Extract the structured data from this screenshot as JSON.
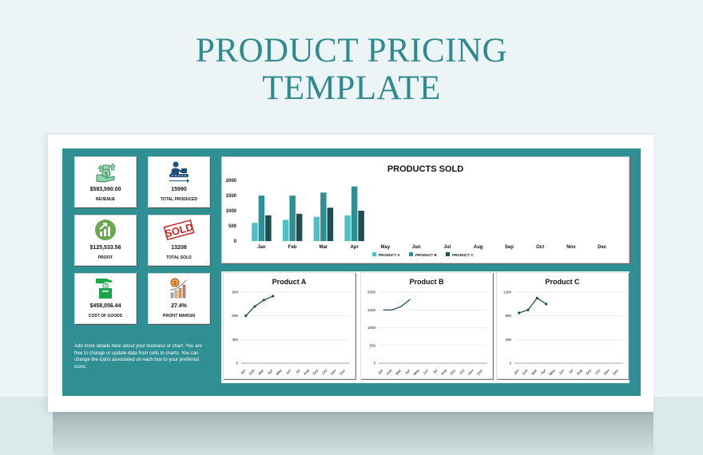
{
  "page": {
    "title_line1": "PRODUCT PRICING",
    "title_line2": "TEMPLATE"
  },
  "kpis": [
    {
      "value": "$583,590.00",
      "label": "REVENUE",
      "icon": "money-growth-icon"
    },
    {
      "value": "15990",
      "label": "TOTAL PRODUCED",
      "icon": "conveyor-worker-icon"
    },
    {
      "value": "$125,533.56",
      "label": "PROFIT",
      "icon": "growth-chart-icon"
    },
    {
      "value": "13208",
      "label": "TOTAL SOLD",
      "icon": "sold-stamp-icon"
    },
    {
      "value": "$458,056.44",
      "label": "COST OF GOODS",
      "icon": "hand-coin-box-icon"
    },
    {
      "value": "27.4%",
      "label": "PROFIT MARGIN",
      "icon": "coin-bar-chart-icon"
    }
  ],
  "sold_stamp_text": "SOLD",
  "note": "Add more details here about your business or chart. You are free to change or update data from cells to charts. You can change the icons associated on each box to your preferred icons.",
  "colors": {
    "teal": "#2f8f93",
    "product_a": "#4fc0c8",
    "product_b": "#2e8f94",
    "product_c": "#1d4f52",
    "line": "#1d4f52"
  },
  "chart_data": [
    {
      "type": "bar",
      "title": "PRODUCTS SOLD",
      "categories": [
        "Jan",
        "Feb",
        "Mar",
        "Apr",
        "May",
        "Jun",
        "Jul",
        "Aug",
        "Sep",
        "Oct",
        "Nov",
        "Dec"
      ],
      "series": [
        {
          "name": "PRODUCT A",
          "values": [
            600,
            700,
            800,
            850,
            null,
            null,
            null,
            null,
            null,
            null,
            null,
            null
          ]
        },
        {
          "name": "PRODUCT B",
          "values": [
            1500,
            1500,
            1600,
            1800,
            null,
            null,
            null,
            null,
            null,
            null,
            null,
            null
          ]
        },
        {
          "name": "PRODUCT C",
          "values": [
            850,
            900,
            1100,
            1000,
            null,
            null,
            null,
            null,
            null,
            null,
            null,
            null
          ]
        }
      ],
      "yticks": [
        0,
        500,
        1000,
        1500,
        2000
      ],
      "ylim": [
        0,
        2000
      ],
      "legend": "bottom",
      "xlabel": "",
      "ylabel": ""
    },
    {
      "type": "line",
      "title": "Product A",
      "categories": [
        "Jan",
        "Feb",
        "Mar",
        "Apr",
        "May",
        "Jun",
        "Jul",
        "Aug",
        "Sep",
        "Oct",
        "Nov",
        "Dec"
      ],
      "values": [
        600,
        720,
        800,
        850,
        null,
        null,
        null,
        null,
        null,
        null,
        null,
        null
      ],
      "yticks": [
        0,
        300,
        600,
        900
      ],
      "ylim": [
        0,
        900
      ],
      "markers": true
    },
    {
      "type": "line",
      "title": "Product B",
      "categories": [
        "Jan",
        "Feb",
        "Mar",
        "Apr",
        "May",
        "Jun",
        "Jul",
        "Aug",
        "Sep",
        "Oct",
        "Nov",
        "Dec"
      ],
      "values": [
        1500,
        1500,
        1600,
        1800,
        null,
        null,
        null,
        null,
        null,
        null,
        null,
        null
      ],
      "yticks": [
        0,
        500,
        1000,
        1500,
        2000
      ],
      "ylim": [
        0,
        2000
      ],
      "markers": false
    },
    {
      "type": "line",
      "title": "Product C",
      "categories": [
        "Jan",
        "Feb",
        "Mar",
        "Apr",
        "May",
        "Jun",
        "Jul",
        "Aug",
        "Sep",
        "Oct",
        "Nov",
        "Dec"
      ],
      "values": [
        850,
        900,
        1100,
        1000,
        null,
        null,
        null,
        null,
        null,
        null,
        null,
        null
      ],
      "yticks": [
        0,
        400,
        800,
        1200
      ],
      "ylim": [
        0,
        1200
      ],
      "markers": true
    }
  ]
}
